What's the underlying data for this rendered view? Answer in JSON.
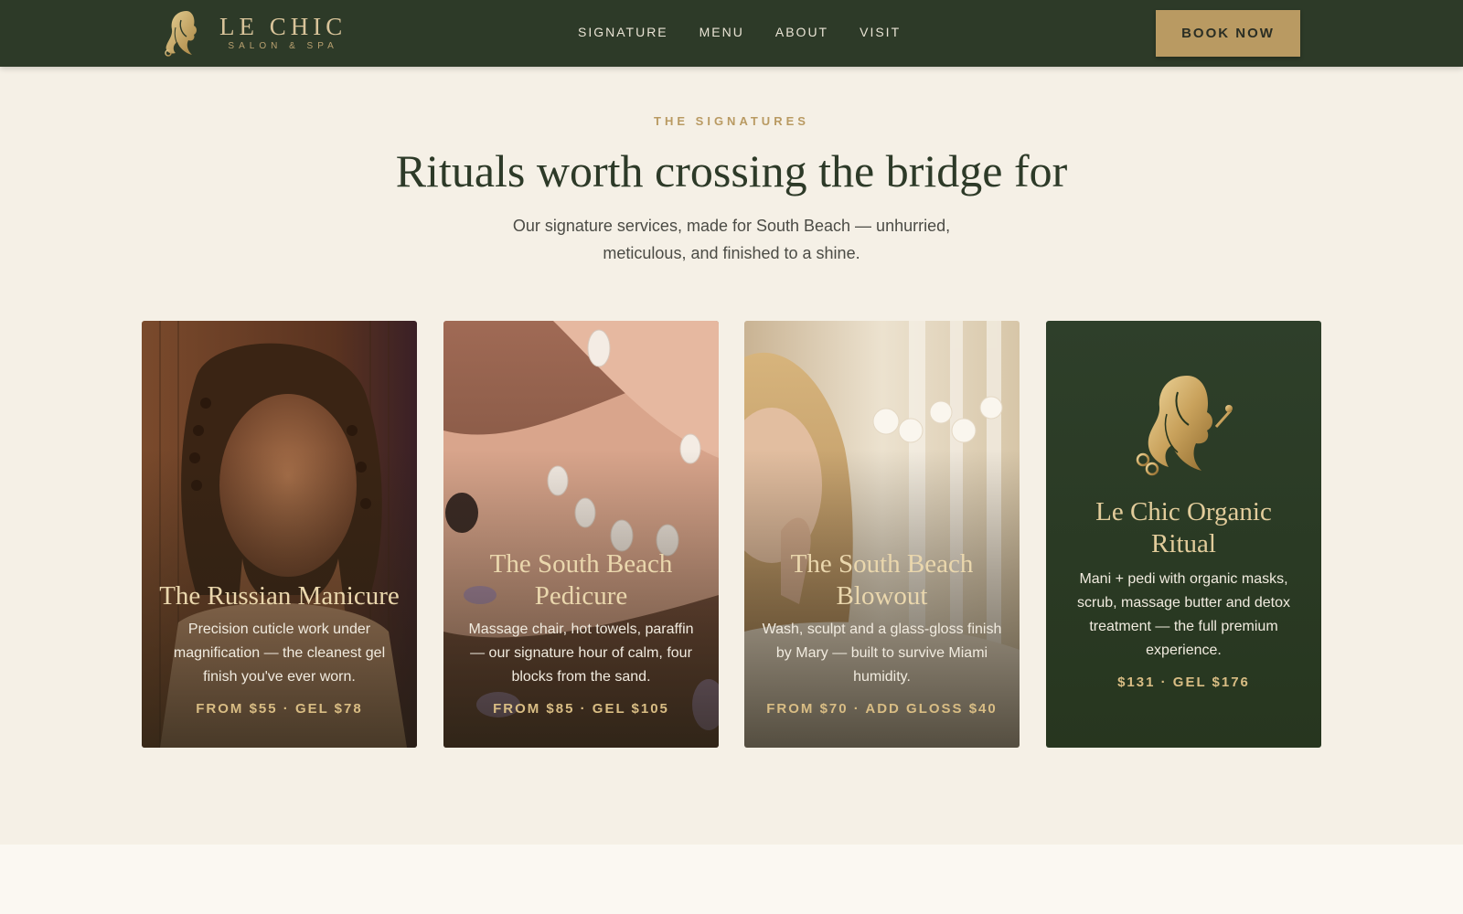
{
  "brand": {
    "name": "LE CHIC",
    "tagline": "SALON & SPA",
    "colors": {
      "topbar": "#2d3a28",
      "gold": "#b99a62",
      "cream": "#f5f0e6",
      "dark_green": "#2d3a28"
    }
  },
  "nav": {
    "items": [
      {
        "label": "SIGNATURE"
      },
      {
        "label": "MENU"
      },
      {
        "label": "ABOUT"
      },
      {
        "label": "VISIT"
      }
    ],
    "cta": "BOOK NOW"
  },
  "section": {
    "eyebrow": "THE SIGNATURES",
    "title": "Rituals worth crossing the bridge for",
    "subtitle": "Our signature services, made for South Beach — unhurried, meticulous, and finished to a shine."
  },
  "cards": [
    {
      "title": "The Russian Manicure",
      "description": "Precision cuticle work under magnification — the cleanest gel finish you've ever worn.",
      "price": "FROM $55 · GEL $78",
      "image": "woman-portrait-photo"
    },
    {
      "title": "The South Beach Pedicure",
      "description": "Massage chair, hot towels, paraffin — our signature hour of calm, four blocks from the sand.",
      "price": "FROM $85 · GEL $105",
      "image": "manicured-hands-photo"
    },
    {
      "title": "The South Beach Blowout",
      "description": "Wash, sculpt and a glass-gloss finish by Mary — built to survive Miami humidity.",
      "price": "FROM $70 · ADD GLOSS $40",
      "image": "blonde-woman-orchids-photo"
    },
    {
      "title": "Le Chic Organic Ritual",
      "description": "Mani + pedi with organic masks, scrub, massage butter and detox treatment — the full premium experience.",
      "price": "$131 · GEL $176",
      "image": "gold-emblem-icon"
    }
  ]
}
